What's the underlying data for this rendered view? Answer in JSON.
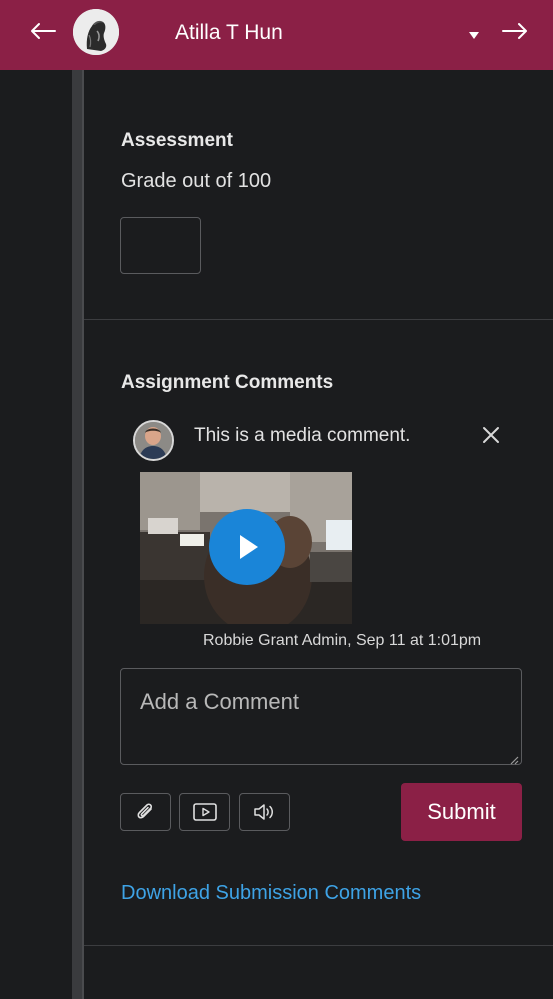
{
  "header": {
    "student_name": "Atilla T Hun"
  },
  "assessment": {
    "title": "Assessment",
    "grade_label": "Grade out of 100",
    "grade_value": ""
  },
  "comments": {
    "title": "Assignment Comments",
    "items": [
      {
        "text": "This is a media comment.",
        "meta": "Robbie Grant Admin, Sep 11 at 1:01pm"
      }
    ],
    "input_placeholder": "Add a Comment",
    "submit_label": "Submit",
    "download_link": "Download Submission Comments"
  },
  "colors": {
    "brand": "#8b2046",
    "link": "#3ea3e6",
    "play": "#1a85d8",
    "background": "#1b1c1e"
  },
  "icons": {
    "prev": "arrow-left-icon",
    "next": "arrow-right-icon",
    "caret": "caret-down-icon",
    "close": "close-icon",
    "play": "play-icon",
    "attach": "paperclip-icon",
    "media": "video-icon",
    "audio": "speaker-icon"
  }
}
